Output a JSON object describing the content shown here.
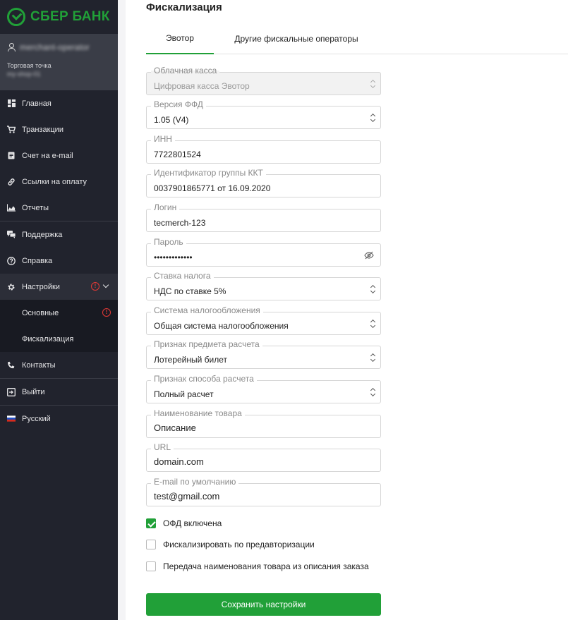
{
  "brand": {
    "name": "СБЕР БАНК",
    "color": "#21a038"
  },
  "account": {
    "user_name": "merchant-operator",
    "store_label": "Торговая точка",
    "store_name": "my-shop-01"
  },
  "sidebar": {
    "items": [
      {
        "label": "Главная",
        "icon": "dashboard-icon"
      },
      {
        "label": "Транзакции",
        "icon": "cart-icon"
      },
      {
        "label": "Счет на e-mail",
        "icon": "invoice-icon"
      },
      {
        "label": "Ссылки на оплату",
        "icon": "link-icon"
      },
      {
        "label": "Отчеты",
        "icon": "chart-icon"
      },
      {
        "label": "Поддержка",
        "icon": "chat-icon"
      },
      {
        "label": "Справка",
        "icon": "help-icon"
      },
      {
        "label": "Настройки",
        "icon": "gear-icon"
      },
      {
        "label": "Контакты",
        "icon": "phone-icon"
      },
      {
        "label": "Выйти",
        "icon": "logout-icon"
      },
      {
        "label": "Русский",
        "icon": "flag-ru-icon"
      }
    ],
    "settings_sub": [
      {
        "label": "Основные"
      },
      {
        "label": "Фискализация"
      }
    ]
  },
  "page": {
    "title": "Фискализация"
  },
  "tabs": [
    {
      "label": "Эвотор"
    },
    {
      "label": "Другие фискальные операторы"
    }
  ],
  "form": {
    "cloud_kassa": {
      "label": "Облачная касса",
      "value": "Цифровая касса Эвотор"
    },
    "ffd_version": {
      "label": "Версия ФФД",
      "value": "1.05 (V4)"
    },
    "inn": {
      "label": "ИНН",
      "value": "7722801524"
    },
    "kkt_group": {
      "label": "Идентификатор группы ККТ",
      "value": "0037901865771 от 16.09.2020"
    },
    "login": {
      "label": "Логин",
      "value": "tecmerch-123"
    },
    "password": {
      "label": "Пароль",
      "value": "•••••••••••••"
    },
    "tax_rate": {
      "label": "Ставка налога",
      "value": "НДС по ставке 5%"
    },
    "tax_system": {
      "label": "Система налогообложения",
      "value": "Общая система налогообложения"
    },
    "item_type": {
      "label": "Признак предмета расчета",
      "value": "Лотерейный билет"
    },
    "payment_method": {
      "label": "Признак способа расчета",
      "value": "Полный расчет"
    },
    "item_name": {
      "label": "Наименование товара",
      "value": "Описание"
    },
    "url": {
      "label": "URL",
      "value": "domain.com"
    },
    "email": {
      "label": "E-mail по умолчанию",
      "value": "test@gmail.com"
    }
  },
  "checkboxes": [
    {
      "label": "ОФД включена",
      "checked": true
    },
    {
      "label": "Фискализировать по предавторизации",
      "checked": false
    },
    {
      "label": "Передача наименования товара из описания заказа",
      "checked": false
    }
  ],
  "actions": {
    "save_label": "Сохранить настройки"
  },
  "colors": {
    "accent": "#21a038",
    "sidebar_bg": "#21232d",
    "warning": "#e53935"
  }
}
